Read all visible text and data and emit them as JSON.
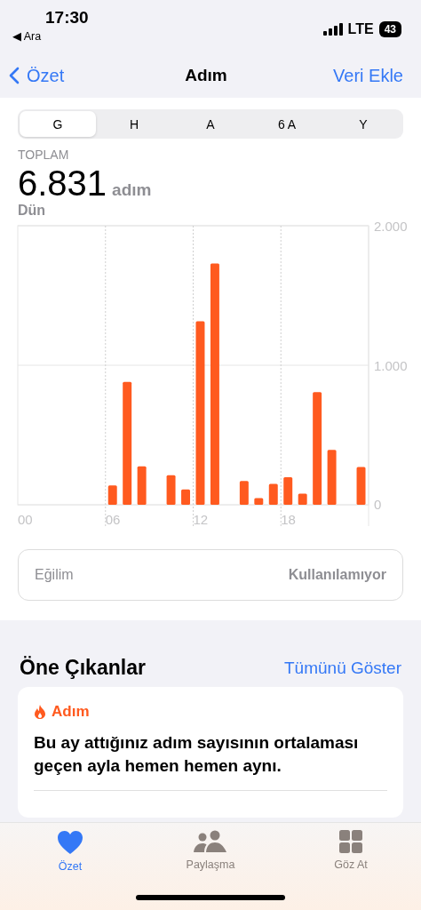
{
  "status_bar": {
    "time": "17:30",
    "back_app": "◀ Ara",
    "network": "LTE",
    "battery": "43"
  },
  "nav": {
    "back": "Özet",
    "title": "Adım",
    "action": "Veri Ekle"
  },
  "segments": [
    {
      "label": "G",
      "selected": true
    },
    {
      "label": "H",
      "selected": false
    },
    {
      "label": "A",
      "selected": false
    },
    {
      "label": "6 A",
      "selected": false
    },
    {
      "label": "Y",
      "selected": false
    }
  ],
  "summary": {
    "label": "TOPLAM",
    "value": "6.831",
    "unit": "adım",
    "date": "Dün"
  },
  "chart": {
    "chart_data": {
      "type": "bar",
      "x": [
        0,
        1,
        2,
        3,
        4,
        5,
        6,
        7,
        8,
        9,
        10,
        11,
        12,
        13,
        14,
        15,
        16,
        17,
        18,
        19,
        20,
        21,
        22,
        23
      ],
      "xlim": [
        -0.5,
        23.5
      ],
      "series": [
        {
          "color": "#ff5a1f",
          "values": [
            0,
            0,
            0,
            0,
            0,
            0,
            138,
            881,
            276,
            0,
            212,
            110,
            1316,
            1730,
            0,
            170,
            47,
            149,
            197,
            79,
            807,
            393,
            0,
            270
          ]
        }
      ],
      "ylim": [
        0,
        2000
      ],
      "yticks": [
        {
          "value": 0,
          "label": "0"
        },
        {
          "value": 1000,
          "label": "1.000"
        },
        {
          "value": 2000,
          "label": "2.000"
        }
      ],
      "xticks": [
        {
          "value": 0,
          "label": "00"
        },
        {
          "value": 6,
          "label": "06"
        },
        {
          "value": 12,
          "label": "12"
        },
        {
          "value": 18,
          "label": "18"
        }
      ]
    }
  },
  "trend": {
    "label": "Eğilim",
    "value": "Kullanılamıyor"
  },
  "highlights": {
    "title": "Öne Çıkanlar",
    "action": "Tümünü Göster",
    "cards": [
      {
        "category": "Adım",
        "text": "Bu ay attığınız adım sayısının ortalaması geçen ayla hemen hemen aynı."
      }
    ]
  },
  "tab_bar": [
    {
      "label": "Özet",
      "kind": "heart",
      "selected": true
    },
    {
      "label": "Paylaşma",
      "kind": "people",
      "selected": false
    },
    {
      "label": "Göz At",
      "kind": "grid",
      "selected": false
    }
  ]
}
